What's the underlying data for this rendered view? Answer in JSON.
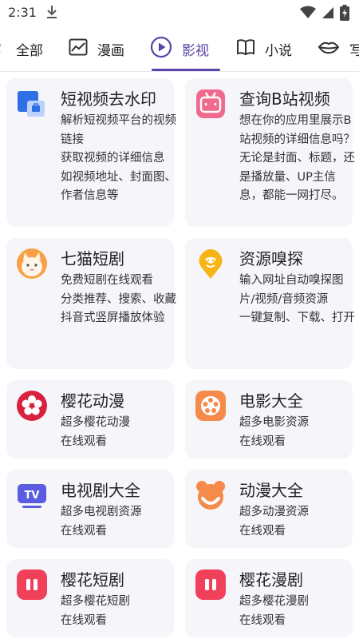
{
  "status_bar": {
    "time": "2:31"
  },
  "tabs": [
    {
      "label": "全部",
      "icon": "grid-icon"
    },
    {
      "label": "漫画",
      "icon": "image-icon"
    },
    {
      "label": "影视",
      "icon": "play-circle-icon",
      "active": true
    },
    {
      "label": "小说",
      "icon": "book-icon"
    },
    {
      "label": "写",
      "icon": "lips-icon"
    }
  ],
  "accent_color": "#5b43a8",
  "cards": [
    {
      "title": "短视频去水印",
      "icon": "watermark-remove-icon",
      "desc": [
        "解析短视频平台的视频链接",
        "获取视频的详细信息",
        "如视频地址、封面图、作者信息等"
      ]
    },
    {
      "title": "查询B站视频",
      "icon": "bilibili-icon",
      "desc": [
        "想在你的应用里展示B站视频的详细信息吗？无论是封面、标题，还是播放量、UP主信息，都能一网打尽。"
      ]
    },
    {
      "title": "七猫短剧",
      "icon": "cat-icon",
      "desc": [
        "免费短剧在线观看",
        "分类推荐、搜索、收藏",
        "抖音式竖屏播放体验"
      ]
    },
    {
      "title": "资源嗅探",
      "icon": "sniff-icon",
      "desc": [
        "输入网址自动嗅探图片/视频/音频资源",
        "一键复制、下载、打开"
      ]
    },
    {
      "title": "樱花动漫",
      "icon": "sakura-icon",
      "desc": [
        "超多樱花动漫",
        "在线观看"
      ]
    },
    {
      "title": "电影大全",
      "icon": "film-reel-icon",
      "desc": [
        "超多电影资源",
        "在线观看"
      ]
    },
    {
      "title": "电视剧大全",
      "icon": "tv-icon",
      "desc": [
        "超多电视剧资源",
        "在线观看"
      ]
    },
    {
      "title": "动漫大全",
      "icon": "bear-icon",
      "desc": [
        "超多动漫资源",
        "在线观看"
      ]
    },
    {
      "title": "樱花短剧",
      "icon": "pause-icon",
      "desc": [
        "超多樱花短剧",
        "在线观看"
      ]
    },
    {
      "title": "樱花漫剧",
      "icon": "pause-icon",
      "desc": [
        "超多樱花漫剧",
        "在线观看"
      ]
    }
  ]
}
